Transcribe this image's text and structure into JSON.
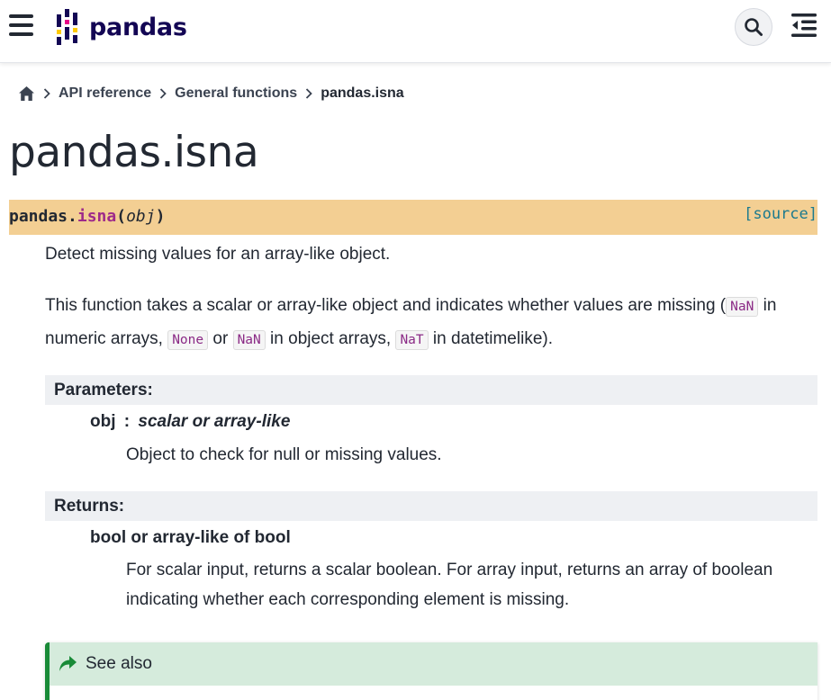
{
  "header": {
    "logo_text": "pandas",
    "menu_icon": "hamburger-menu-icon",
    "search_icon": "search-icon",
    "toc_icon": "toc-toggle-icon"
  },
  "breadcrumb": {
    "home_icon": "home-icon",
    "items": [
      "API reference",
      "General functions",
      "pandas.isna"
    ]
  },
  "title": "pandas.isna",
  "signature": {
    "prefix": "pandas.",
    "name": "isna",
    "open": "(",
    "param": "obj",
    "close": ")",
    "source_label": "[source]"
  },
  "summary": "Detect missing values for an array-like object.",
  "description": {
    "part1": "This function takes a scalar or array-like object and indicates whether values are missing (",
    "code1": "NaN",
    "part2": " in numeric arrays, ",
    "code2": "None",
    "part3": " or ",
    "code3": "NaN",
    "part4": " in object arrays, ",
    "code4": "NaT",
    "part5": " in datetimelike)."
  },
  "parameters": {
    "heading": "Parameters:",
    "name": "obj",
    "separator": ":",
    "type": "scalar or array-like",
    "desc": "Object to check for null or missing values."
  },
  "returns": {
    "heading": "Returns:",
    "type": "bool or array-like of bool",
    "desc_line1": "For scalar input, returns a scalar boolean. For array input, returns an array of boolean",
    "desc_line2": "indicating whether each corresponding element is missing."
  },
  "see_also": {
    "title": "See also",
    "icon": "share-arrow-icon"
  },
  "colors": {
    "signature_bg": "#f3cf93",
    "function_name": "#9e2a8a",
    "source_link": "#1c7a8e",
    "see_also_accent": "#198b38",
    "see_also_bg": "#d5ebdc",
    "logo": "#130654"
  }
}
